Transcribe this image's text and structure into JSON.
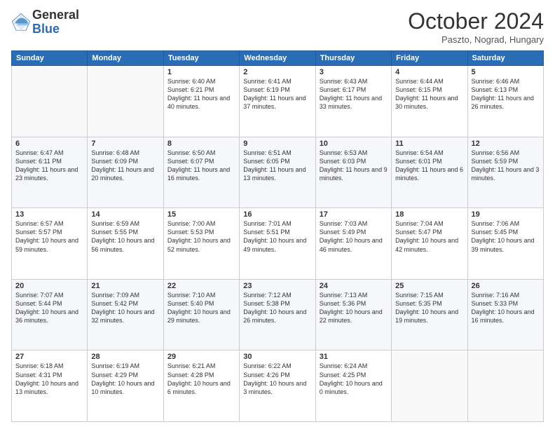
{
  "header": {
    "logo_general": "General",
    "logo_blue": "Blue",
    "month_title": "October 2024",
    "location": "Paszto, Nograd, Hungary"
  },
  "days_of_week": [
    "Sunday",
    "Monday",
    "Tuesday",
    "Wednesday",
    "Thursday",
    "Friday",
    "Saturday"
  ],
  "weeks": [
    [
      {
        "day": "",
        "sunrise": "",
        "sunset": "",
        "daylight": ""
      },
      {
        "day": "",
        "sunrise": "",
        "sunset": "",
        "daylight": ""
      },
      {
        "day": "1",
        "sunrise": "Sunrise: 6:40 AM",
        "sunset": "Sunset: 6:21 PM",
        "daylight": "Daylight: 11 hours and 40 minutes."
      },
      {
        "day": "2",
        "sunrise": "Sunrise: 6:41 AM",
        "sunset": "Sunset: 6:19 PM",
        "daylight": "Daylight: 11 hours and 37 minutes."
      },
      {
        "day": "3",
        "sunrise": "Sunrise: 6:43 AM",
        "sunset": "Sunset: 6:17 PM",
        "daylight": "Daylight: 11 hours and 33 minutes."
      },
      {
        "day": "4",
        "sunrise": "Sunrise: 6:44 AM",
        "sunset": "Sunset: 6:15 PM",
        "daylight": "Daylight: 11 hours and 30 minutes."
      },
      {
        "day": "5",
        "sunrise": "Sunrise: 6:46 AM",
        "sunset": "Sunset: 6:13 PM",
        "daylight": "Daylight: 11 hours and 26 minutes."
      }
    ],
    [
      {
        "day": "6",
        "sunrise": "Sunrise: 6:47 AM",
        "sunset": "Sunset: 6:11 PM",
        "daylight": "Daylight: 11 hours and 23 minutes."
      },
      {
        "day": "7",
        "sunrise": "Sunrise: 6:48 AM",
        "sunset": "Sunset: 6:09 PM",
        "daylight": "Daylight: 11 hours and 20 minutes."
      },
      {
        "day": "8",
        "sunrise": "Sunrise: 6:50 AM",
        "sunset": "Sunset: 6:07 PM",
        "daylight": "Daylight: 11 hours and 16 minutes."
      },
      {
        "day": "9",
        "sunrise": "Sunrise: 6:51 AM",
        "sunset": "Sunset: 6:05 PM",
        "daylight": "Daylight: 11 hours and 13 minutes."
      },
      {
        "day": "10",
        "sunrise": "Sunrise: 6:53 AM",
        "sunset": "Sunset: 6:03 PM",
        "daylight": "Daylight: 11 hours and 9 minutes."
      },
      {
        "day": "11",
        "sunrise": "Sunrise: 6:54 AM",
        "sunset": "Sunset: 6:01 PM",
        "daylight": "Daylight: 11 hours and 6 minutes."
      },
      {
        "day": "12",
        "sunrise": "Sunrise: 6:56 AM",
        "sunset": "Sunset: 5:59 PM",
        "daylight": "Daylight: 11 hours and 3 minutes."
      }
    ],
    [
      {
        "day": "13",
        "sunrise": "Sunrise: 6:57 AM",
        "sunset": "Sunset: 5:57 PM",
        "daylight": "Daylight: 10 hours and 59 minutes."
      },
      {
        "day": "14",
        "sunrise": "Sunrise: 6:59 AM",
        "sunset": "Sunset: 5:55 PM",
        "daylight": "Daylight: 10 hours and 56 minutes."
      },
      {
        "day": "15",
        "sunrise": "Sunrise: 7:00 AM",
        "sunset": "Sunset: 5:53 PM",
        "daylight": "Daylight: 10 hours and 52 minutes."
      },
      {
        "day": "16",
        "sunrise": "Sunrise: 7:01 AM",
        "sunset": "Sunset: 5:51 PM",
        "daylight": "Daylight: 10 hours and 49 minutes."
      },
      {
        "day": "17",
        "sunrise": "Sunrise: 7:03 AM",
        "sunset": "Sunset: 5:49 PM",
        "daylight": "Daylight: 10 hours and 46 minutes."
      },
      {
        "day": "18",
        "sunrise": "Sunrise: 7:04 AM",
        "sunset": "Sunset: 5:47 PM",
        "daylight": "Daylight: 10 hours and 42 minutes."
      },
      {
        "day": "19",
        "sunrise": "Sunrise: 7:06 AM",
        "sunset": "Sunset: 5:45 PM",
        "daylight": "Daylight: 10 hours and 39 minutes."
      }
    ],
    [
      {
        "day": "20",
        "sunrise": "Sunrise: 7:07 AM",
        "sunset": "Sunset: 5:44 PM",
        "daylight": "Daylight: 10 hours and 36 minutes."
      },
      {
        "day": "21",
        "sunrise": "Sunrise: 7:09 AM",
        "sunset": "Sunset: 5:42 PM",
        "daylight": "Daylight: 10 hours and 32 minutes."
      },
      {
        "day": "22",
        "sunrise": "Sunrise: 7:10 AM",
        "sunset": "Sunset: 5:40 PM",
        "daylight": "Daylight: 10 hours and 29 minutes."
      },
      {
        "day": "23",
        "sunrise": "Sunrise: 7:12 AM",
        "sunset": "Sunset: 5:38 PM",
        "daylight": "Daylight: 10 hours and 26 minutes."
      },
      {
        "day": "24",
        "sunrise": "Sunrise: 7:13 AM",
        "sunset": "Sunset: 5:36 PM",
        "daylight": "Daylight: 10 hours and 22 minutes."
      },
      {
        "day": "25",
        "sunrise": "Sunrise: 7:15 AM",
        "sunset": "Sunset: 5:35 PM",
        "daylight": "Daylight: 10 hours and 19 minutes."
      },
      {
        "day": "26",
        "sunrise": "Sunrise: 7:16 AM",
        "sunset": "Sunset: 5:33 PM",
        "daylight": "Daylight: 10 hours and 16 minutes."
      }
    ],
    [
      {
        "day": "27",
        "sunrise": "Sunrise: 6:18 AM",
        "sunset": "Sunset: 4:31 PM",
        "daylight": "Daylight: 10 hours and 13 minutes."
      },
      {
        "day": "28",
        "sunrise": "Sunrise: 6:19 AM",
        "sunset": "Sunset: 4:29 PM",
        "daylight": "Daylight: 10 hours and 10 minutes."
      },
      {
        "day": "29",
        "sunrise": "Sunrise: 6:21 AM",
        "sunset": "Sunset: 4:28 PM",
        "daylight": "Daylight: 10 hours and 6 minutes."
      },
      {
        "day": "30",
        "sunrise": "Sunrise: 6:22 AM",
        "sunset": "Sunset: 4:26 PM",
        "daylight": "Daylight: 10 hours and 3 minutes."
      },
      {
        "day": "31",
        "sunrise": "Sunrise: 6:24 AM",
        "sunset": "Sunset: 4:25 PM",
        "daylight": "Daylight: 10 hours and 0 minutes."
      },
      {
        "day": "",
        "sunrise": "",
        "sunset": "",
        "daylight": ""
      },
      {
        "day": "",
        "sunrise": "",
        "sunset": "",
        "daylight": ""
      }
    ]
  ]
}
